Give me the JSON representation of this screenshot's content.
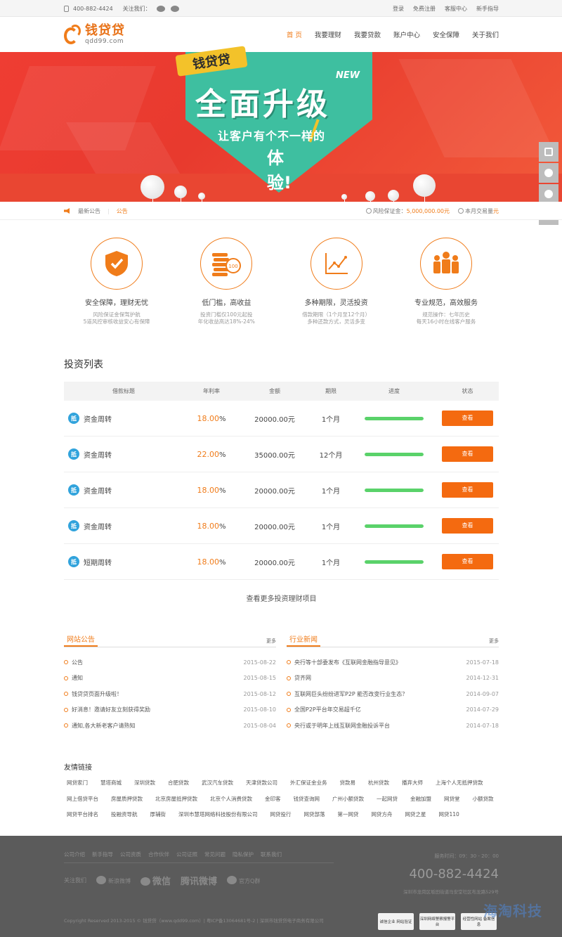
{
  "topbar": {
    "phone": "400-882-4424",
    "follow_label": "关注我们：",
    "links": [
      "登录",
      "免费注册",
      "客服中心",
      "新手指导"
    ]
  },
  "header": {
    "logo_cn": "钱贷贷",
    "logo_en": "qdd99.com",
    "nav": [
      "首 页",
      "我要理财",
      "我要贷款",
      "账户中心",
      "安全保障",
      "关于我们"
    ],
    "active_index": 0
  },
  "banner": {
    "tag": "钱贷贷",
    "new_label": "NEW",
    "headline": "全面升级",
    "sub": "让客户有个不一样的",
    "sub2": "体验!"
  },
  "notice": {
    "label": "最新公告",
    "item": "公告",
    "guarantee_label": "风险保证金：",
    "guarantee_value": "5,000,000.00元",
    "monthly_label": "本月交易量",
    "monthly_value": "元"
  },
  "features": [
    {
      "icon": "shield-check-icon",
      "title": "安全保障，理财无忧",
      "line1": "风险保证金保驾护航",
      "line2": "5道风控审核收益安心有保障"
    },
    {
      "icon": "coins-icon",
      "title": "低门槛，高收益",
      "line1": "投资门槛仅100元起投",
      "line2": "年化收益高达18%-24%"
    },
    {
      "icon": "trend-chart-icon",
      "title": "多种期限，灵活投资",
      "line1": "借款期限（1个月至12个月）",
      "line2": "多种还款方式，灵活多变"
    },
    {
      "icon": "team-people-icon",
      "title": "专业规范，高效服务",
      "line1": "规范操作：七年历史",
      "line2": "每天16小时在线客户服务"
    }
  ],
  "invest": {
    "title": "投资列表",
    "headers": [
      "借款标题",
      "年利率",
      "金额",
      "期限",
      "进度",
      "状态"
    ],
    "rows": [
      {
        "badge": "抵",
        "title": "资金周转",
        "rate": "18.00",
        "pct": "%",
        "amount": "20000.00元",
        "term": "1个月",
        "progress": 100,
        "action": "查看"
      },
      {
        "badge": "抵",
        "title": "资金周转",
        "rate": "22.00",
        "pct": "%",
        "amount": "35000.00元",
        "term": "12个月",
        "progress": 100,
        "action": "查看"
      },
      {
        "badge": "抵",
        "title": "资金周转",
        "rate": "18.00",
        "pct": "%",
        "amount": "20000.00元",
        "term": "1个月",
        "progress": 100,
        "action": "查看"
      },
      {
        "badge": "抵",
        "title": "资金周转",
        "rate": "18.00",
        "pct": "%",
        "amount": "20000.00元",
        "term": "1个月",
        "progress": 100,
        "action": "查看"
      },
      {
        "badge": "抵",
        "title": "短期周转",
        "rate": "18.00",
        "pct": "%",
        "amount": "20000.00元",
        "term": "1个月",
        "progress": 100,
        "action": "查看"
      }
    ],
    "more": "查看更多投资理财项目"
  },
  "news_site": {
    "title": "网站公告",
    "more": "更多",
    "items": [
      {
        "t": "公告",
        "d": "2015-08-22"
      },
      {
        "t": "通知",
        "d": "2015-08-15"
      },
      {
        "t": "钱贷贷页面升级啦！",
        "d": "2015-08-12"
      },
      {
        "t": "好消息！邀请好友立刻获得奖励",
        "d": "2015-08-10"
      },
      {
        "t": "通知,各大新老客户请熟知",
        "d": "2015-08-04"
      }
    ]
  },
  "news_industry": {
    "title": "行业新闻",
    "more": "更多",
    "items": [
      {
        "t": "央行等十部委发布《互联网金融指导意见》",
        "d": "2015-07-18"
      },
      {
        "t": "贷齐网",
        "d": "2014-12-31"
      },
      {
        "t": "互联网巨头纷纷进军P2P 能否改变行业生态？",
        "d": "2014-09-07"
      },
      {
        "t": "全国P2P平台年交易超千亿",
        "d": "2014-07-29"
      },
      {
        "t": "央行或于明年上线互联网金融投诉平台",
        "d": "2014-07-18"
      }
    ]
  },
  "links": {
    "title": "友情链接",
    "items": [
      "网贷家门",
      "慧塔商城",
      "深圳贷款",
      "合肥贷款",
      "武汉汽车贷款",
      "天津贷款公司",
      "外汇保证金业务",
      "贷款易",
      "杭州贷款",
      "播弃大师",
      "上海个人无抵押贷款",
      "网上借贷平台",
      "房屋质押贷款",
      "北京房屋抵押贷款",
      "北京个人消费贷款",
      "金印客",
      "钱贷查询网",
      "广州小额贷款",
      "一起网贷",
      "金融加盟",
      "网贷堂",
      "小额贷款",
      "网贷平台排名",
      "投融资导航",
      "厚辅街",
      "深圳市慧塔网络科技股份有限公司",
      "网贷投行",
      "网贷部落",
      "第一网贷",
      "网贷方舟",
      "网贷之星",
      "网贷110"
    ]
  },
  "footer": {
    "nav": [
      "公司介绍",
      "新手指导",
      "公司资质",
      "合作伙伴",
      "公司证照",
      "常见问题",
      "隐私保护",
      "联系我们"
    ],
    "follow_label": "关注我们",
    "socials": [
      "新浪微博",
      "微信",
      "腾讯微博",
      "官方Q群"
    ],
    "hours": "服务时间：09：30 - 20：00",
    "phone": "400-882-4424",
    "address": "深圳市龙岗区坂田街道马安堂社区布龙路529号",
    "copyright": "Copyright Reserved 2013-2015 © 钱贷贷（www.qdd99.com）| 粤ICP备13064681号-2 | 深圳市钱贷贷电子商务有限公司",
    "badges": [
      "诚信企业 网站验证",
      "深圳网络警察报警平台",
      "经营性网站 备案信息"
    ],
    "watermark": "海淘科技"
  },
  "colors": {
    "accent": "#f07c1a",
    "button": "#f46a10",
    "progress": "#5ad26a",
    "badge": "#31a3dc",
    "footer": "#5b5b5b",
    "banner": "#ef3d33"
  }
}
